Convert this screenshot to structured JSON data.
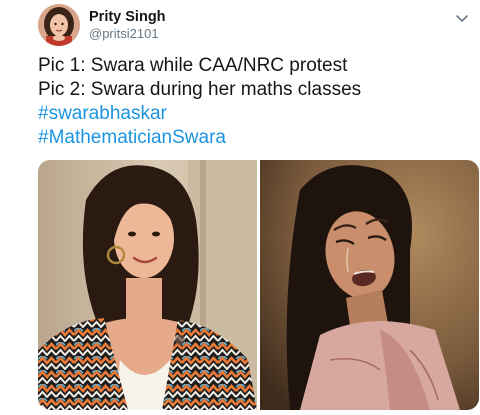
{
  "author": {
    "display_name": "Prity Singh",
    "handle": "@pritsi2101",
    "avatar_icon": "profile-avatar"
  },
  "tweet": {
    "lines": [
      "Pic 1: Swara while CAA/NRC protest",
      "Pic 2: Swara during her maths classes"
    ],
    "hashtags": [
      "#swarabhaskar",
      "#MathematicianSwara"
    ]
  },
  "media": {
    "count": 2,
    "pic1_icon": "photo-smiling-woman",
    "pic2_icon": "photo-crying-woman"
  },
  "menu": {
    "icon": "chevron-down-icon"
  },
  "colors": {
    "text": "#14171a",
    "secondary": "#657786",
    "link": "#1b95e0"
  }
}
